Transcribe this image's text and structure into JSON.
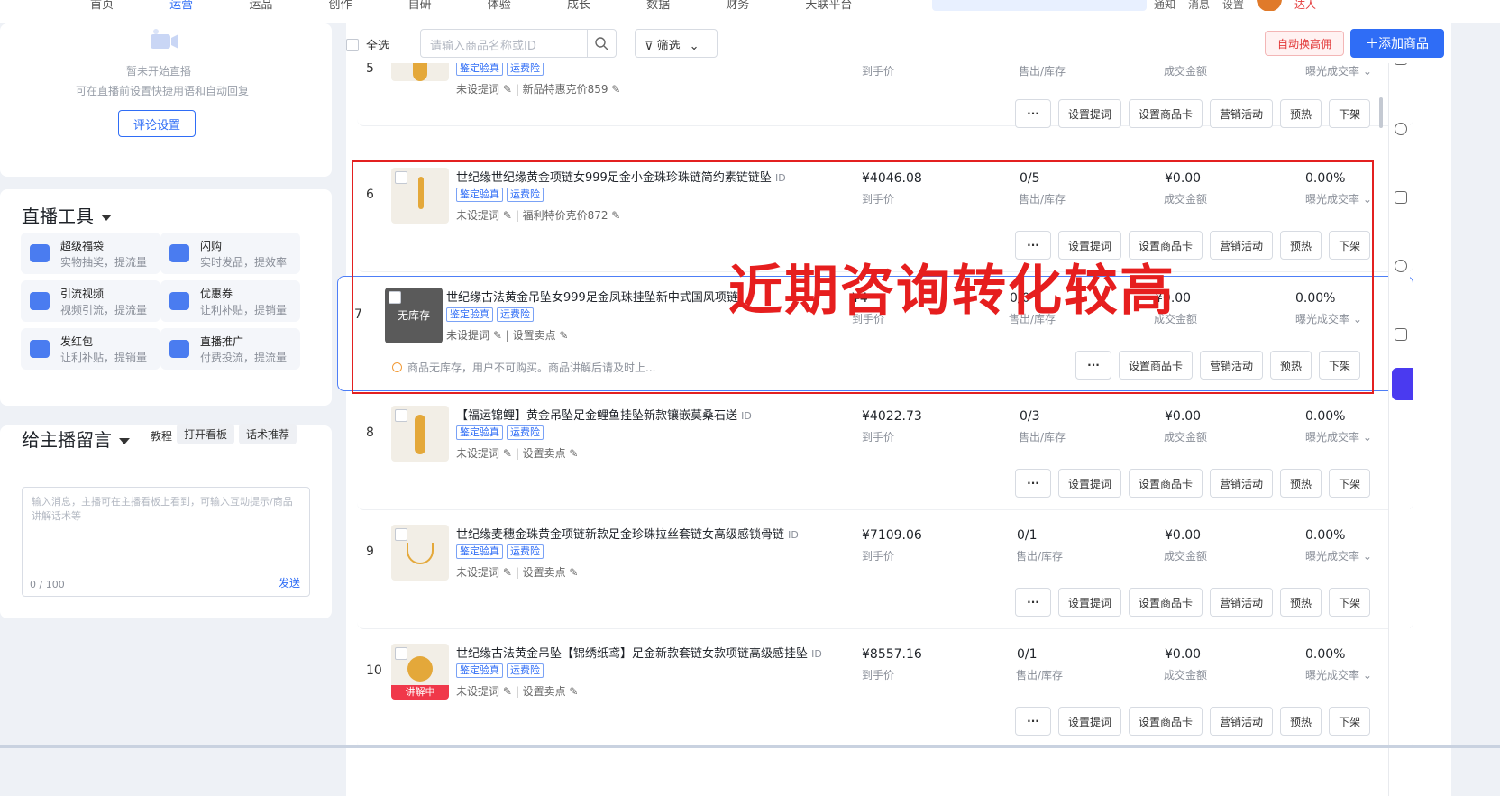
{
  "topnav": {
    "items": [
      "首页",
      "运营",
      "运品",
      "创作",
      "自研",
      "体验",
      "成长",
      "数据",
      "财务",
      "天联平台"
    ],
    "active_index": 1
  },
  "top_search_placeholder": "",
  "top_right": {
    "a": "通知",
    "b": "消息",
    "c": "设置",
    "d": "达人"
  },
  "left": {
    "live_status": "暂未开始直播",
    "live_hint": "可在直播前设置快捷用语和自动回复",
    "comment_settings_button": "评论设置",
    "tools_title": "直播工具",
    "tools": [
      {
        "name": "超级福袋",
        "desc": "实物抽奖，提流量",
        "icon": "gift-bag-icon"
      },
      {
        "name": "闪购",
        "desc": "实时发品，提效率",
        "icon": "flash-buy-icon"
      },
      {
        "name": "引流视频",
        "desc": "视频引流，提流量",
        "icon": "video-icon"
      },
      {
        "name": "优惠券",
        "desc": "让利补贴，提销量",
        "icon": "coupon-icon"
      },
      {
        "name": "发红包",
        "desc": "让利补贴，提销量",
        "icon": "red-packet-icon"
      },
      {
        "name": "直播推广",
        "desc": "付费投流，提流量",
        "icon": "promote-icon"
      }
    ],
    "message_title": "给主播留言",
    "message_tutorial": "教程",
    "message_open_board": "打开看板",
    "message_script": "话术推荐",
    "message_placeholder": "输入消息，主播可在主播看板上看到，可输入互动提示/商品讲解话术等",
    "message_count": "0 / 100",
    "message_send": "发送"
  },
  "toolbar": {
    "select_all": "全选",
    "search_placeholder": "请输入商品名称或ID",
    "filter_label": "筛选",
    "auto_swap": "自动换高佣",
    "add_product": "添加商品"
  },
  "labels": {
    "price": "到手价",
    "sold_stock": "售出/库存",
    "gmv": "成交金额",
    "ctr": "曝光成交率",
    "tag1": "鉴定验真",
    "tag2": "运费险",
    "no_prompt": "未设提词",
    "set_selling_point": "设置卖点",
    "btn_more": "···",
    "btn_prompt": "设置提词",
    "btn_card": "设置商品卡",
    "btn_marketing": "营销活动",
    "btn_warm": "预热",
    "btn_offshelf": "下架",
    "no_stock": "无库存",
    "explaining": "讲解中",
    "no_stock_warning": "商品无库存，用户不可购买。商品讲解后请及时上...",
    "id_tag": "ID"
  },
  "products": [
    {
      "num": "5",
      "title": "",
      "price": "",
      "sold": "",
      "gmv": "",
      "ctr": "",
      "extra": "新品特惠克价859"
    },
    {
      "num": "6",
      "title": "世纪缘世纪缘黄金项链女999足金小金珠珍珠链简约素链链坠",
      "price": "¥4046.08",
      "sold": "0/5",
      "gmv": "¥0.00",
      "ctr": "0.00%",
      "extra": "福利特价克价872"
    },
    {
      "num": "7",
      "title": "世纪缘古法黄金吊坠女999足金凤珠挂坠新中式国风项链",
      "price": "¥4",
      "sold": "0/0",
      "gmv": "¥0.00",
      "ctr": "0.00%",
      "extra": ""
    },
    {
      "num": "8",
      "title": "【福运锦鲤】黄金吊坠足金鲤鱼挂坠新款镶嵌莫桑石送",
      "price": "¥4022.73",
      "sold": "0/3",
      "gmv": "¥0.00",
      "ctr": "0.00%",
      "extra": ""
    },
    {
      "num": "9",
      "title": "世纪缘麦穗金珠黄金项链新款足金珍珠拉丝套链女高级感锁骨链",
      "price": "¥7109.06",
      "sold": "0/1",
      "gmv": "¥0.00",
      "ctr": "0.00%",
      "extra": ""
    },
    {
      "num": "10",
      "title": "世纪缘古法黄金吊坠【锦绣纸鸢】足金新款套链女款项链高级感挂坠",
      "price": "¥8557.16",
      "sold": "0/1",
      "gmv": "¥0.00",
      "ctr": "0.00%",
      "extra": ""
    }
  ],
  "annotation": {
    "text": "近期咨询转化较高",
    "color": "#e61e1e"
  },
  "colors": {
    "accent": "#2f6df6",
    "danger": "#e23a3a"
  }
}
